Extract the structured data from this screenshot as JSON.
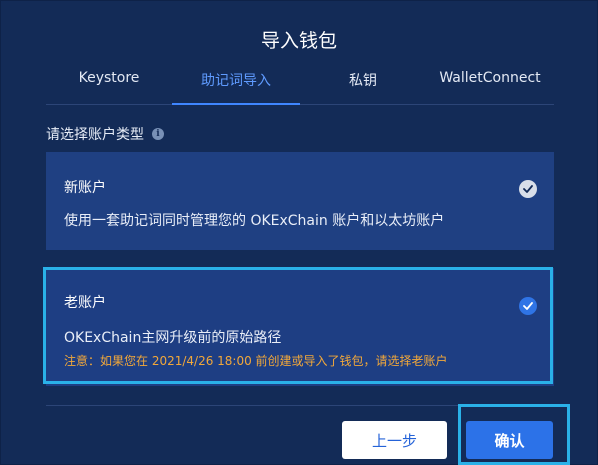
{
  "dialog": {
    "title": "导入钱包"
  },
  "tabs": [
    {
      "label": "Keystore"
    },
    {
      "label": "助记词导入"
    },
    {
      "label": "私钥"
    },
    {
      "label": "WalletConnect"
    }
  ],
  "active_tab": "助记词导入",
  "section_label": "请选择账户类型",
  "info_icon": "i",
  "accounts": [
    {
      "title": "新账户",
      "description": "使用一套助记词同时管理您的 OKExChain 账户和以太坊账户",
      "selected": false
    },
    {
      "title": "老账户",
      "description": "OKExChain主网升级前的原始路径",
      "note": "注意：如果您在 2021/4/26 18:00 前创建或导入了钱包，请选择老账户",
      "selected": true
    }
  ],
  "buttons": {
    "prev": "上一步",
    "confirm": "确认"
  },
  "colors": {
    "background": "#132b57",
    "card": "#1f4082",
    "accent": "#3f86ff",
    "highlight": "#2ab1e8",
    "warning": "#f2a83a"
  }
}
